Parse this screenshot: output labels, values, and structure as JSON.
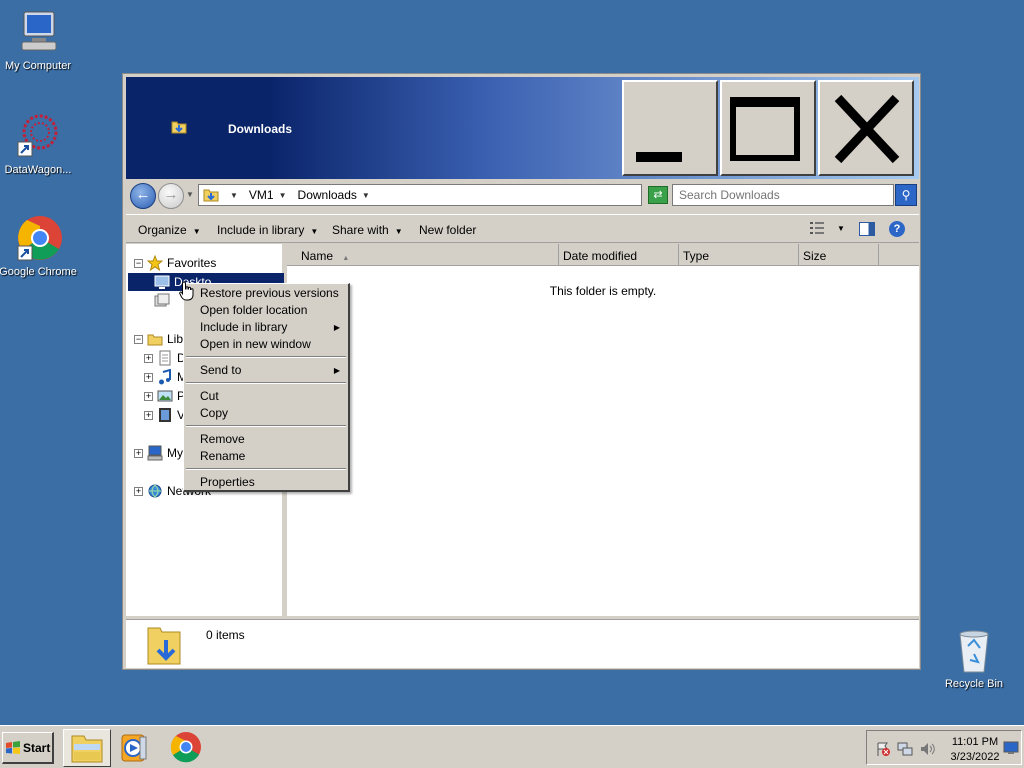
{
  "desktop": {
    "icons": [
      {
        "label": "My Computer"
      },
      {
        "label": "DataWagon..."
      },
      {
        "label": "Google Chrome"
      },
      {
        "label": "Recycle Bin"
      }
    ]
  },
  "window": {
    "title": "Downloads",
    "address": {
      "crumbs": [
        "VM1",
        "Downloads"
      ]
    },
    "search_placeholder": "Search Downloads",
    "commands": {
      "organize": "Organize",
      "include_in_library": "Include in library",
      "share_with": "Share with",
      "new_folder": "New folder"
    },
    "nav_tree": {
      "favorites": "Favorites",
      "selected_item_partial": "Deskto",
      "libraries_partial": "Libr",
      "lib_items_partial": [
        "D",
        "M",
        "P",
        "V"
      ],
      "computer_partial": "My",
      "network": "Network"
    },
    "columns": [
      "Name",
      "Date modified",
      "Type",
      "Size"
    ],
    "empty_message": "This folder is empty.",
    "details": {
      "item_count": "0 items"
    }
  },
  "context_menu": {
    "group1": [
      "Restore previous versions",
      "Open folder location",
      "Include in library",
      "Open in new window"
    ],
    "group2": [
      "Send to"
    ],
    "group3": [
      "Cut",
      "Copy"
    ],
    "group4": [
      "Remove",
      "Rename"
    ],
    "group5": [
      "Properties"
    ]
  },
  "taskbar": {
    "start_label": "Start",
    "clock": {
      "time": "11:01 PM",
      "date": "3/23/2022"
    }
  },
  "colors": {
    "desktop": "#3a6ea5",
    "selection": "#0a246a",
    "chrome_face": "#d4d0c8"
  }
}
